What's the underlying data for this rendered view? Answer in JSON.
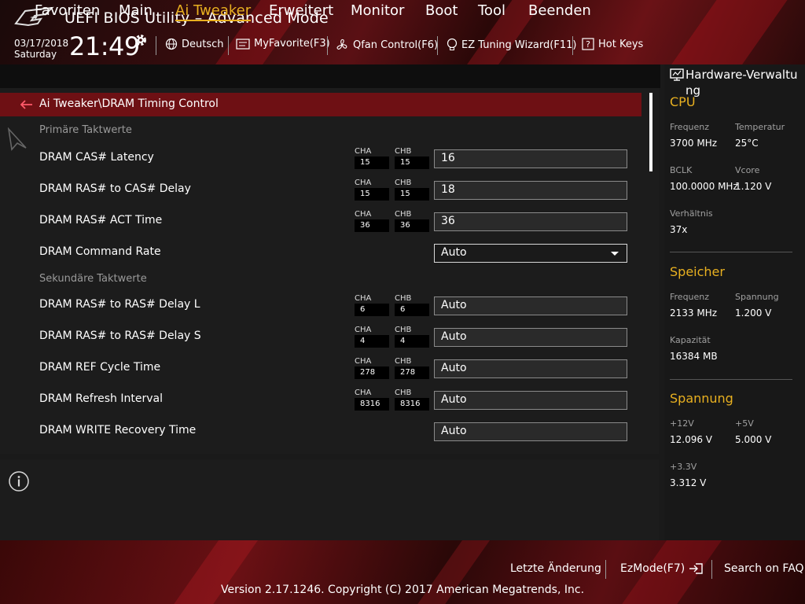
{
  "app": {
    "title": "UEFI BIOS Utility – Advanced Mode"
  },
  "status": {
    "date": "03/17/2018",
    "day": "Saturday",
    "time": "21:49"
  },
  "toolbar": {
    "language": "Deutsch",
    "myfavorite": "MyFavorite(F3)",
    "qfan": "Qfan Control(F6)",
    "eztuning": "EZ Tuning Wizard(F11)",
    "hotkeys": "Hot Keys"
  },
  "nav": {
    "tabs": [
      "Favoriten",
      "Main",
      "Ai Tweaker",
      "Erweitert",
      "Monitor",
      "Boot",
      "Tool",
      "Beenden"
    ],
    "active": "Ai Tweaker"
  },
  "breadcrumb": "Ai Tweaker\\DRAM Timing Control",
  "sections": {
    "primary": "Primäre Taktwerte",
    "secondary": "Sekundäre Taktwerte"
  },
  "channel_labels": {
    "a": "CHA",
    "b": "CHB"
  },
  "rows": [
    {
      "label": "DRAM CAS# Latency",
      "cha": "15",
      "chb": "15",
      "value": "16"
    },
    {
      "label": "DRAM RAS# to CAS# Delay",
      "cha": "15",
      "chb": "15",
      "value": "18"
    },
    {
      "label": "DRAM RAS# ACT Time",
      "cha": "36",
      "chb": "36",
      "value": "36"
    },
    {
      "label": "DRAM Command Rate",
      "value": "Auto"
    },
    {
      "label": "DRAM RAS# to RAS# Delay L",
      "cha": "6",
      "chb": "6",
      "value": "Auto"
    },
    {
      "label": "DRAM RAS# to RAS# Delay S",
      "cha": "4",
      "chb": "4",
      "value": "Auto"
    },
    {
      "label": "DRAM REF Cycle Time",
      "cha": "278",
      "chb": "278",
      "value": "Auto"
    },
    {
      "label": "DRAM Refresh Interval",
      "cha": "8316",
      "chb": "8316",
      "value": "Auto"
    },
    {
      "label": "DRAM WRITE Recovery Time",
      "value": "Auto"
    }
  ],
  "hardware": {
    "title": "Hardware-Verwaltung",
    "cpu": {
      "heading": "CPU",
      "freq_label": "Frequenz",
      "freq": "3700 MHz",
      "temp_label": "Temperatur",
      "temp": "25°C",
      "bclk_label": "BCLK",
      "bclk": "100.0000 MHz",
      "vcore_label": "Vcore",
      "vcore": "1.120 V",
      "ratio_label": "Verhältnis",
      "ratio": "37x"
    },
    "memory": {
      "heading": "Speicher",
      "freq_label": "Frequenz",
      "freq": "2133 MHz",
      "volt_label": "Spannung",
      "volt": "1.200 V",
      "cap_label": "Kapazität",
      "cap": "16384 MB"
    },
    "voltage": {
      "heading": "Spannung",
      "v12_label": "+12V",
      "v12": "12.096 V",
      "v5_label": "+5V",
      "v5": "5.000 V",
      "v33_label": "+3.3V",
      "v33": "3.312 V"
    }
  },
  "footer": {
    "last_change": "Letzte Änderung",
    "ezmode": "EzMode(F7)",
    "faq": "Search on FAQ",
    "copyright": "Version 2.17.1246. Copyright (C) 2017 American Megatrends, Inc."
  }
}
